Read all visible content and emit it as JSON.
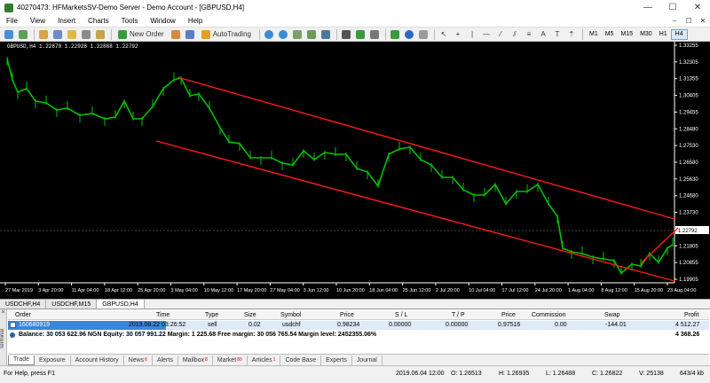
{
  "window": {
    "title": "40270473: HFMarketsSV-Demo Server - Demo Account - [GBPUSD,H4]",
    "minimize": "—",
    "maximize": "☐",
    "close": "✕"
  },
  "menu": {
    "items": [
      "File",
      "View",
      "Insert",
      "Charts",
      "Tools",
      "Window",
      "Help"
    ],
    "mdi": [
      "–",
      "☐",
      "✕"
    ]
  },
  "toolbar": {
    "new_order": "New Order",
    "autotrading": "AutoTrading",
    "timeframes": [
      "M1",
      "M5",
      "M15",
      "M30",
      "H1",
      "H4"
    ],
    "active_timeframe": "H4"
  },
  "chart": {
    "label": "GBPUSD,H4  1.22870 1.22928 1.22868 1.22792",
    "current_price": "1.22792",
    "price_ticks": [
      "1.33255",
      "1.32305",
      "1.31355",
      "1.30405",
      "1.29455",
      "1.28480",
      "1.27530",
      "1.26580",
      "1.25630",
      "1.24680",
      "1.23730",
      "1.22780",
      "1.21805",
      "1.20855",
      "1.19905"
    ],
    "date_ticks": [
      "27 Mar 2019",
      "3 Apr 20:00",
      "11 Apr 04:00",
      "18 Apr 12:00",
      "25 Apr 20:00",
      "3 May 04:00",
      "10 May 12:00",
      "17 May 20:00",
      "27 May 04:00",
      "3 Jun 12:00",
      "10 Jun 20:00",
      "18 Jun 04:00",
      "25 Jun 12:00",
      "2 Jul 20:00",
      "10 Jul 04:00",
      "17 Jul 12:00",
      "24 Jul 20:00",
      "1 Aug 04:00",
      "8 Aug 12:00",
      "15 Aug 20:00",
      "23 Aug 04:00"
    ],
    "colors": {
      "background": "#000000",
      "candles": "#00c000",
      "trendline": "#ff1a1a",
      "axis_text": "#ffffff"
    }
  },
  "chart_tabs": [
    "USDCHF,H4",
    "USDCHF,M15",
    "GBPUSD,H4"
  ],
  "terminal": {
    "side_label": "Terminal",
    "close": "×",
    "columns": [
      "Order",
      "Time",
      "Type",
      "Size",
      "Symbol",
      "Price",
      "S / L",
      "T / P",
      "Price",
      "Commission",
      "Swap",
      "Profit"
    ],
    "order": {
      "id": "160680919",
      "time": "2019.08.22 03:26:52",
      "type": "sell",
      "size": "0.02",
      "symbol": "usdchf",
      "price": "0.98234",
      "sl": "0.00000",
      "tp": "0.00000",
      "current_price": "0.97516",
      "commission": "0.00",
      "swap": "-144.01",
      "profit": "4 512.27"
    },
    "balance_line": "Balance: 30 053 622.96 NGN  Equity: 30 057 991.22  Margin: 1 225.68  Free margin: 30 056 765.54  Margin level: 2452355.06%",
    "balance_profit": "4 368.26",
    "tabs": [
      {
        "label": "Trade",
        "badge": ""
      },
      {
        "label": "Exposure",
        "badge": ""
      },
      {
        "label": "Account History",
        "badge": ""
      },
      {
        "label": "News",
        "badge": "6"
      },
      {
        "label": "Alerts",
        "badge": ""
      },
      {
        "label": "Mailbox",
        "badge": "8"
      },
      {
        "label": "Market",
        "badge": "80"
      },
      {
        "label": "Articles",
        "badge": "1"
      },
      {
        "label": "Code Base",
        "badge": ""
      },
      {
        "label": "Experts",
        "badge": ""
      },
      {
        "label": "Journal",
        "badge": ""
      }
    ]
  },
  "status": {
    "help": "For Help, press F1",
    "time": "2019.06.04 12:00",
    "open": "O: 1.26513",
    "high": "H: 1.26935",
    "low": "L: 1.26488",
    "close": "C: 1.26822",
    "volume": "V: 25138",
    "traffic": "643/4 kb"
  }
}
